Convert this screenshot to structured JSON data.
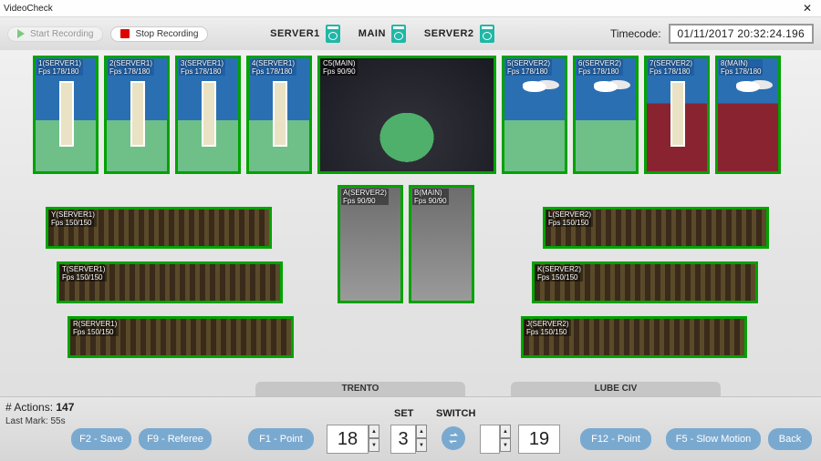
{
  "window": {
    "title": "VideoCheck",
    "close": "✕"
  },
  "toolbar": {
    "start": "Start Recording",
    "stop": "Stop Recording",
    "server1": "SERVER1",
    "main": "MAIN",
    "server2": "SERVER2",
    "tc_label": "Timecode:",
    "tc_value": "01/11/2017 20:32:24.196"
  },
  "feeds": {
    "top": [
      {
        "id": "1(SERVER1)",
        "fps": "Fps 178/180"
      },
      {
        "id": "2(SERVER1)",
        "fps": "Fps 178/180"
      },
      {
        "id": "3(SERVER1)",
        "fps": "Fps 178/180"
      },
      {
        "id": "4(SERVER1)",
        "fps": "Fps 178/180"
      },
      {
        "id": "C5(MAIN)",
        "fps": "Fps  90/90"
      },
      {
        "id": "5(SERVER2)",
        "fps": "Fps 178/180"
      },
      {
        "id": "6(SERVER2)",
        "fps": "Fps 178/180"
      },
      {
        "id": "7(SERVER2)",
        "fps": "Fps 178/180"
      },
      {
        "id": "8(MAIN)",
        "fps": "Fps 178/180"
      }
    ],
    "mid": [
      {
        "id": "A(SERVER2)",
        "fps": "Fps  90/90"
      },
      {
        "id": "B(MAIN)",
        "fps": "Fps  90/90"
      }
    ],
    "sideL": [
      {
        "id": "Y(SERVER1)",
        "fps": "Fps 150/150"
      },
      {
        "id": "T(SERVER1)",
        "fps": "Fps 150/150"
      },
      {
        "id": "R(SERVER1)",
        "fps": "Fps 150/150"
      }
    ],
    "sideR": [
      {
        "id": "L(SERVER2)",
        "fps": "Fps 150/150"
      },
      {
        "id": "K(SERVER2)",
        "fps": "Fps 150/150"
      },
      {
        "id": "J(SERVER2)",
        "fps": "Fps 150/150"
      }
    ]
  },
  "teams": {
    "left": "TRENTO",
    "right": "LUBE CIV"
  },
  "status": {
    "actions_label": "# Actions:",
    "actions": "147",
    "lastmark": "Last Mark: 55s"
  },
  "labels": {
    "set": "SET",
    "switch": "SWITCH"
  },
  "score": {
    "left": "18",
    "set": "3",
    "right": "19",
    "switch_blank": ""
  },
  "buttons": {
    "f2": "F2 - Save",
    "f9": "F9 - Referee",
    "f1": "F1 - Point",
    "f12": "F12 - Point",
    "f5": "F5 - Slow Motion",
    "back": "Back"
  }
}
